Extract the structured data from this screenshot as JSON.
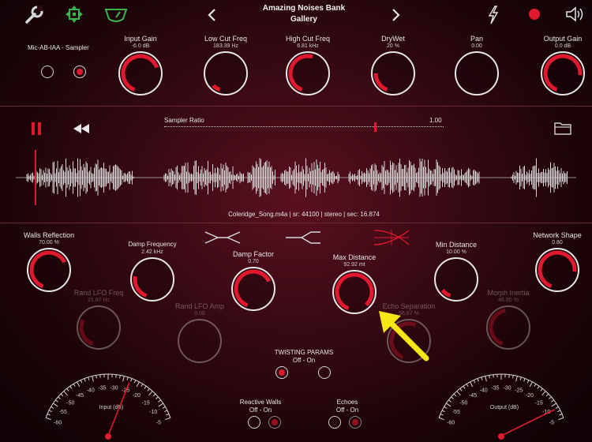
{
  "header": {
    "title_line1": "Amazing Noises Bank",
    "title_line2": "Gallery"
  },
  "top": {
    "input_label": "Mic-AB-IAA - Sampler",
    "knobs": [
      {
        "id": "input-gain",
        "label": "Input Gain",
        "value": "-6.0 dB",
        "level": 0.72
      },
      {
        "id": "low-cut",
        "label": "Low Cut Freq",
        "value": "183.39 Hz",
        "level": 0.08
      },
      {
        "id": "high-cut",
        "label": "High Cut Freq",
        "value": "6.81 kHz",
        "level": 0.55
      },
      {
        "id": "drywet",
        "label": "DryWet",
        "value": "20 %",
        "level": 0.22
      },
      {
        "id": "pan",
        "label": "Pan",
        "value": "0.00",
        "level": 0.0
      },
      {
        "id": "output-gain",
        "label": "Output Gain",
        "value": "0.0 dB",
        "level": 0.8
      }
    ]
  },
  "sampler": {
    "ratio_label": "Sampler Ratio",
    "ratio_value": "1.00",
    "ratio_position": 0.75,
    "file_info": "Coleridge_Song.m4a | sr: 44100 | stereo | sec: 16.874"
  },
  "params": {
    "walls_reflection": {
      "label": "Walls Reflection",
      "value": "70.00 %",
      "level": 0.7
    },
    "damp_frequency": {
      "label": "Damp Frequency",
      "value": "2.42 kHz",
      "level": 0.25
    },
    "damp_factor": {
      "label": "Damp Factor",
      "value": "0.70",
      "level": 0.7
    },
    "max_distance": {
      "label": "Max Distance",
      "value": "92.92 mt",
      "level": 0.93
    },
    "min_distance": {
      "label": "Min Distance",
      "value": "10.00 %",
      "level": 0.1
    },
    "network_shape": {
      "label": "Network Shape",
      "value": "0.80",
      "level": 0.8
    },
    "rand_lfo_freq": {
      "label": "Rand LFO Freq",
      "value": "21.87 Hz",
      "level": 0.3
    },
    "rand_lfo_amp": {
      "label": "Rand LFO Amp",
      "value": "0.00",
      "level": 0.0
    },
    "echo_separation": {
      "label": "Echo Separation",
      "value": "56.67 %",
      "level": 0.57
    },
    "morph_inertia": {
      "label": "Morph Inertia",
      "value": "46.80 %",
      "level": 0.47
    }
  },
  "twisting": {
    "label": "TWISTING PARAMS",
    "options": "Off - On"
  },
  "reactive_walls": {
    "label": "Reactive Walls",
    "options": "Off - On"
  },
  "echoes": {
    "label": "Echoes",
    "options": "Off - On"
  },
  "meters": {
    "input": {
      "label": "Input (dB)",
      "ticks": [
        "-60",
        "-55",
        "-50",
        "-45",
        "-40",
        "-35",
        "-30",
        "-25",
        "-20",
        "-15",
        "-10",
        "-5"
      ]
    },
    "output": {
      "label": "Output (dB)",
      "ticks": [
        "-60",
        "-55",
        "-50",
        "-45",
        "-40",
        "-35",
        "-30",
        "-25",
        "-20",
        "-15",
        "-10",
        "-5"
      ]
    }
  },
  "colors": {
    "accent": "#e0192e",
    "green": "#39b54a",
    "knob_track": "#e6e6e6"
  }
}
